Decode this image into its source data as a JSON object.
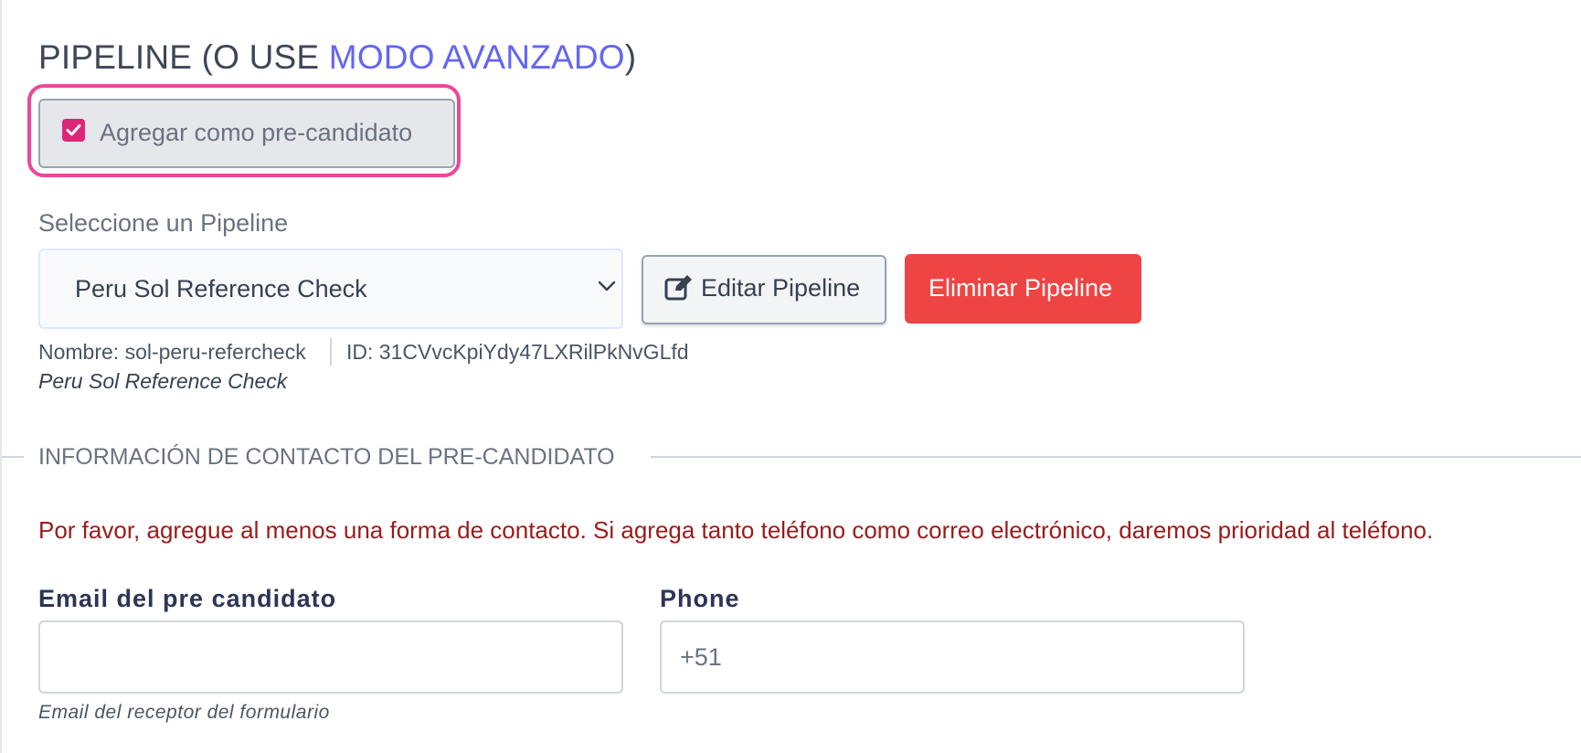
{
  "heading": {
    "prefix": "PIPELINE (O USE ",
    "link": "MODO AVANZADO",
    "suffix": ")"
  },
  "precandidate_checkbox": {
    "label": "Agregar como pre-candidato",
    "checked": true
  },
  "pipeline_select": {
    "label": "Seleccione un Pipeline",
    "selected": "Peru Sol Reference Check"
  },
  "buttons": {
    "edit": "Editar Pipeline",
    "delete": "Eliminar Pipeline"
  },
  "pipeline_meta": {
    "name": "Nombre: sol-peru-refercheck",
    "id": "ID: 31CVvcKpiYdy47LXRilPkNvGLfd",
    "description": "Peru Sol Reference Check"
  },
  "contact_section": {
    "title": "INFORMACIÓN DE CONTACTO DEL PRE-CANDIDATO",
    "warning": "Por favor, agregue al menos una forma de contacto. Si agrega tanto teléfono como correo electrónico, daremos prioridad al teléfono.",
    "email": {
      "label": "Email del pre candidato",
      "value": "",
      "help": "Email del receptor del formulario"
    },
    "phone": {
      "label": "Phone",
      "placeholder": "+51"
    }
  },
  "colors": {
    "link": "#6366f1",
    "highlight": "#ec4899",
    "checkbox": "#db2777",
    "danger": "#ef4444",
    "warning_text": "#991b1b"
  },
  "icons": {
    "checkbox": "check-icon",
    "select": "chevron-down-icon",
    "edit": "edit-icon"
  }
}
